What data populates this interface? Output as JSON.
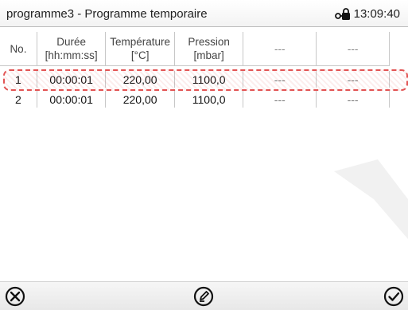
{
  "header": {
    "title": "programme3 - Programme temporaire",
    "time": "13:09:40",
    "lock_icon": "lock-key-icon"
  },
  "table": {
    "columns": [
      {
        "line1": "No.",
        "line2": ""
      },
      {
        "line1": "Durée",
        "line2": "[hh:mm:ss]"
      },
      {
        "line1": "Température",
        "line2": "[°C]"
      },
      {
        "line1": "Pression",
        "line2": "[mbar]"
      },
      {
        "line1": "---",
        "line2": ""
      },
      {
        "line1": "---",
        "line2": ""
      }
    ],
    "rows": [
      {
        "no": "1",
        "duree": "00:00:01",
        "temp": "220,00",
        "pression": "1100,0",
        "c5": "---",
        "c6": "---",
        "selected": true
      },
      {
        "no": "2",
        "duree": "00:00:01",
        "temp": "220,00",
        "pression": "1100,0",
        "c5": "---",
        "c6": "---",
        "selected": false
      }
    ]
  },
  "footer": {
    "cancel_icon": "close-circle-icon",
    "edit_icon": "edit-pencil-icon",
    "confirm_icon": "checkmark-circle-icon"
  }
}
